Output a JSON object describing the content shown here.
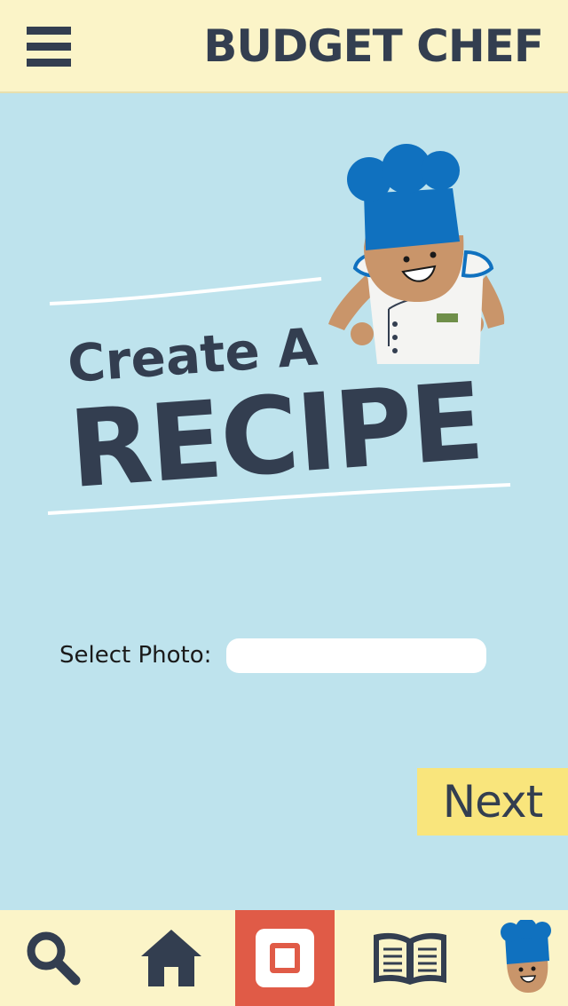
{
  "header": {
    "title": "BUDGET CHEF",
    "menu_icon": "hamburger-menu-icon"
  },
  "hero": {
    "line1": "Create A",
    "line2": "RECIPE"
  },
  "form": {
    "photo_label": "Select Photo:",
    "photo_value": ""
  },
  "actions": {
    "next_label": "Next"
  },
  "tabbar": {
    "items": [
      {
        "icon": "search-icon"
      },
      {
        "icon": "home-icon"
      },
      {
        "icon": "create-recipe-icon"
      },
      {
        "icon": "book-icon"
      },
      {
        "icon": "chef-profile-icon"
      }
    ],
    "active_color": "#e05b47"
  },
  "colors": {
    "background": "#bee3ed",
    "header": "#fbf4c8",
    "navy": "#333e50",
    "accent_yellow": "#f9e57c",
    "chef_hat": "#1071bf"
  }
}
